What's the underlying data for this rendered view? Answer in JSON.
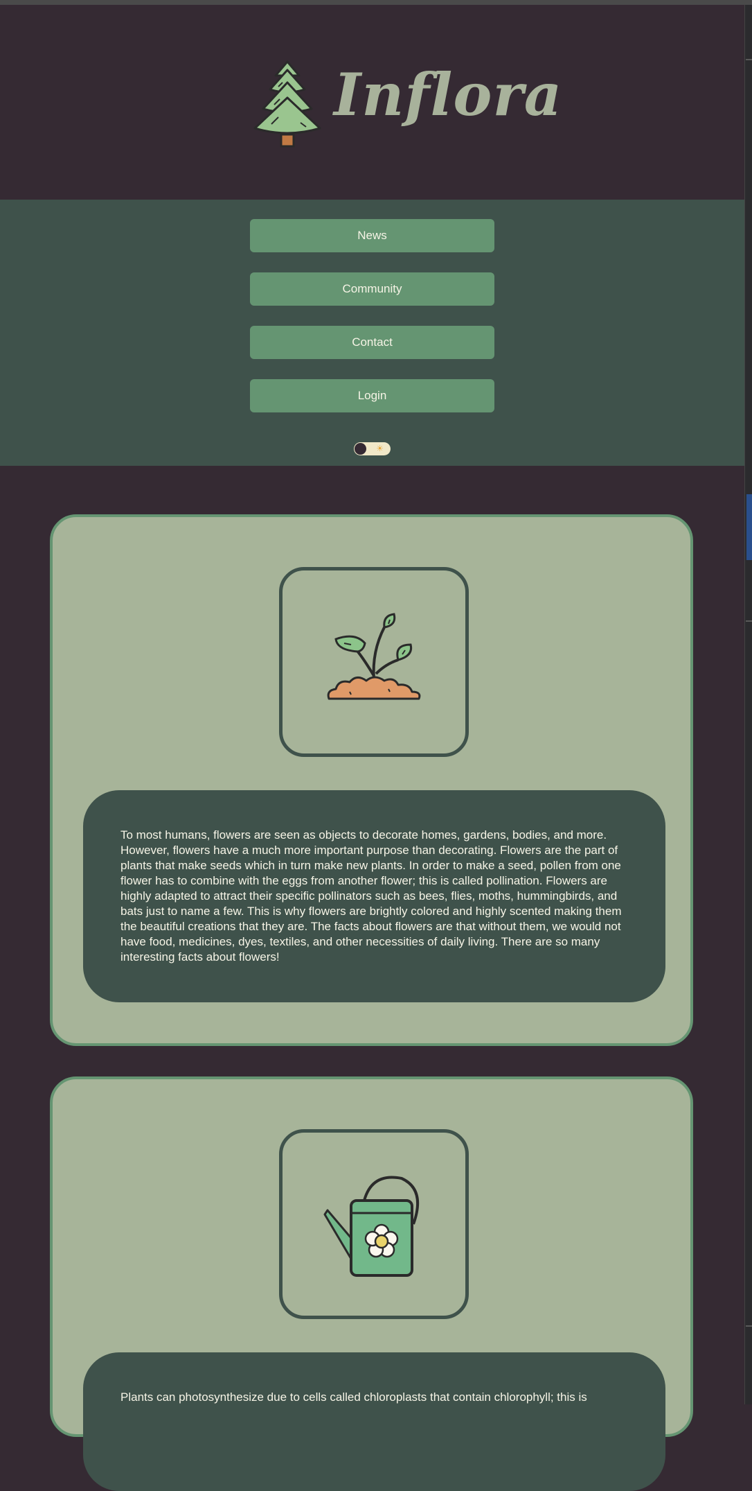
{
  "header": {
    "logo_text": "Inflora",
    "logo_icon": "tree-icon"
  },
  "nav": {
    "items": [
      {
        "label": "News"
      },
      {
        "label": "Community"
      },
      {
        "label": "Contact"
      },
      {
        "label": "Login"
      }
    ],
    "theme_toggle": {
      "icon": "sun-icon",
      "state": "dark"
    }
  },
  "cards": [
    {
      "icon": "sprout-icon",
      "text": "To most humans, flowers are seen as objects to decorate homes, gardens, bodies, and more. However, flowers have a much more important purpose than decorating. Flowers are the part of plants that make seeds which in turn make new plants. In order to make a seed, pollen from one flower has to combine with the eggs from another flower; this is called pollination. Flowers are highly adapted to attract their specific pollinators such as bees, flies, moths, hummingbirds, and bats just to name a few. This is why flowers are brightly colored and highly scented making them the beautiful creations that they are. The facts about flowers are that without them, we would not have food, medicines, dyes, textiles, and other necessities of daily living. There are so many interesting facts about flowers!"
    },
    {
      "icon": "watering-can-icon",
      "text": "Plants can photosynthesize due to cells called chloroplasts that contain chlorophyll; this is"
    }
  ],
  "colors": {
    "background": "#352a33",
    "nav_background": "#3f524b",
    "button": "#659572",
    "card": "#a7b499",
    "text_box": "#3f524b",
    "text": "#f6f4e6"
  }
}
